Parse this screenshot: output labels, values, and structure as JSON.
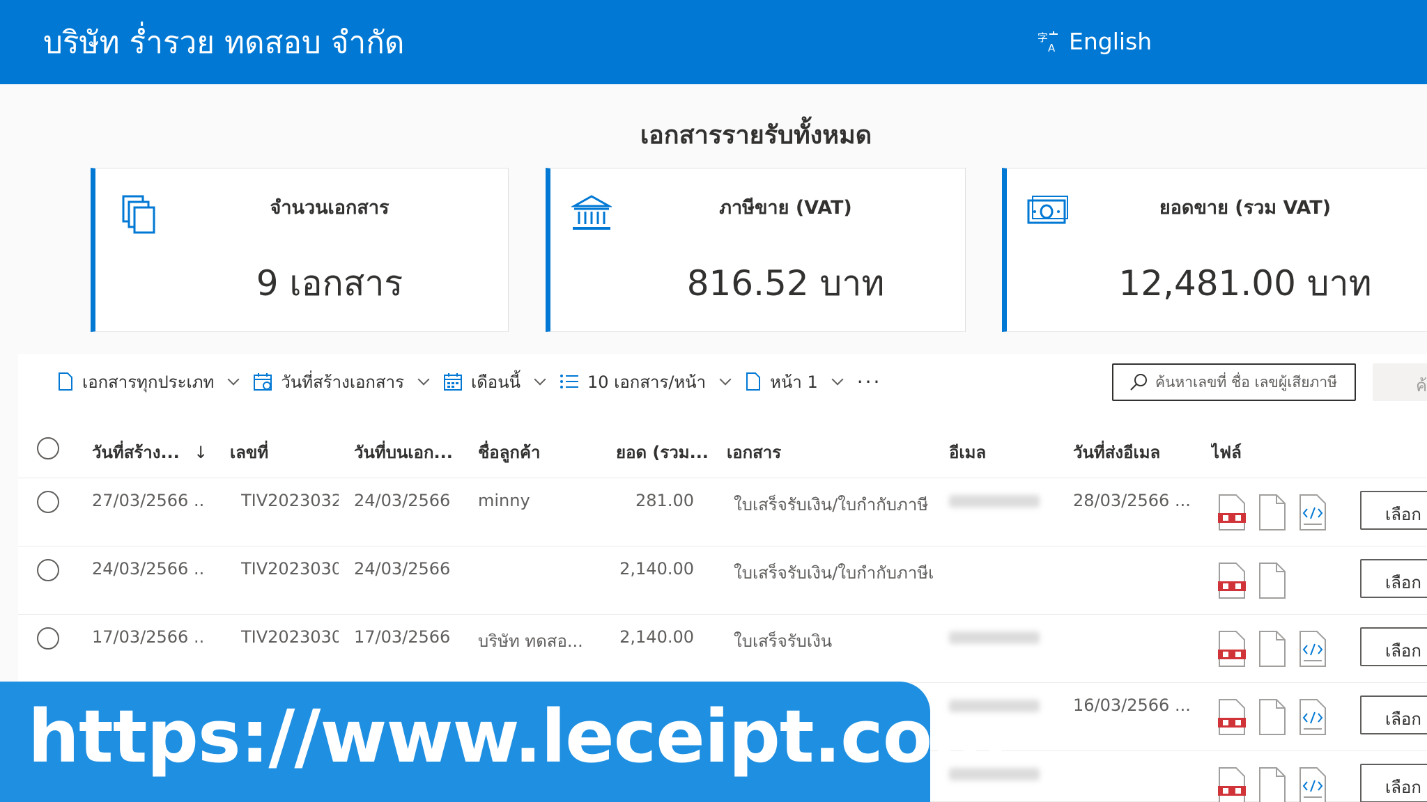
{
  "header": {
    "company_name": "บริษัท ร่ำรวย ทดสอบ จำกัด",
    "language_label": "English"
  },
  "section_title": "เอกสารรายรับทั้งหมด",
  "summary_cards": [
    {
      "label": "จำนวนเอกสาร",
      "value": "9 เอกสาร",
      "icon": "documents-icon"
    },
    {
      "label": "ภาษีขาย (VAT)",
      "value": "816.52 บาท",
      "icon": "bank-icon"
    },
    {
      "label": "ยอดขาย (รวม VAT)",
      "value": "12,481.00 บาท",
      "icon": "money-icon"
    }
  ],
  "toolbar": {
    "doc_type": "เอกสารทุกประเภท",
    "date_type": "วันที่สร้างเอกสาร",
    "period": "เดือนนี้",
    "page_size": "10 เอกสาร/หน้า",
    "page": "หน้า 1",
    "more": "···",
    "search_placeholder": "ค้นหาเลขที่ ชื่อ เลขผู้เสียภาษี",
    "search_button": "ค้น"
  },
  "table": {
    "columns": [
      "วันที่สร้าง...",
      "เลขที่",
      "วันที่บนเอก...",
      "ชื่อลูกค้า",
      "ยอด (รวม...",
      "เอกสาร",
      "อีเมล",
      "วันที่ส่งอีเมล",
      "ไฟล์"
    ],
    "sort_indicator": "↓",
    "rows": [
      {
        "created": "27/03/2566 ...",
        "number": "TIV2023032",
        "doc_date": "24/03/2566",
        "customer": "minny",
        "amount": "281.00",
        "document": "ใบเสร็จรับเงิน/ใบกำกับภาษี",
        "email_sent": "28/03/2566 ...",
        "files": [
          "pdf",
          "blank",
          "xml"
        ]
      },
      {
        "created": "24/03/2566 ...",
        "number": "TIV2023030",
        "doc_date": "24/03/2566",
        "customer": "",
        "amount": "2,140.00",
        "document": "ใบเสร็จรับเงิน/ใบกำกับภาษีเ",
        "email_sent": "",
        "files": [
          "pdf",
          "blank"
        ]
      },
      {
        "created": "17/03/2566 ...",
        "number": "TIV2023030",
        "doc_date": "17/03/2566",
        "customer": "บริษัท ทดสอ...",
        "amount": "2,140.00",
        "document": "ใบเสร็จรับเงิน",
        "email_sent": "",
        "files": [
          "pdf",
          "blank",
          "xml"
        ]
      },
      {
        "created": "",
        "number": "",
        "doc_date": "",
        "customer": "",
        "amount": "",
        "document": "",
        "email_sent": "16/03/2566 ...",
        "files": [
          "pdf",
          "blank",
          "xml"
        ]
      },
      {
        "created": "",
        "number": "",
        "doc_date": "",
        "customer": "",
        "amount": "",
        "document": "",
        "email_sent": "",
        "files": [
          "pdf",
          "blank",
          "xml"
        ]
      }
    ],
    "select_label": "เลือก"
  },
  "banner": {
    "url": "https://www.leceipt.com"
  }
}
